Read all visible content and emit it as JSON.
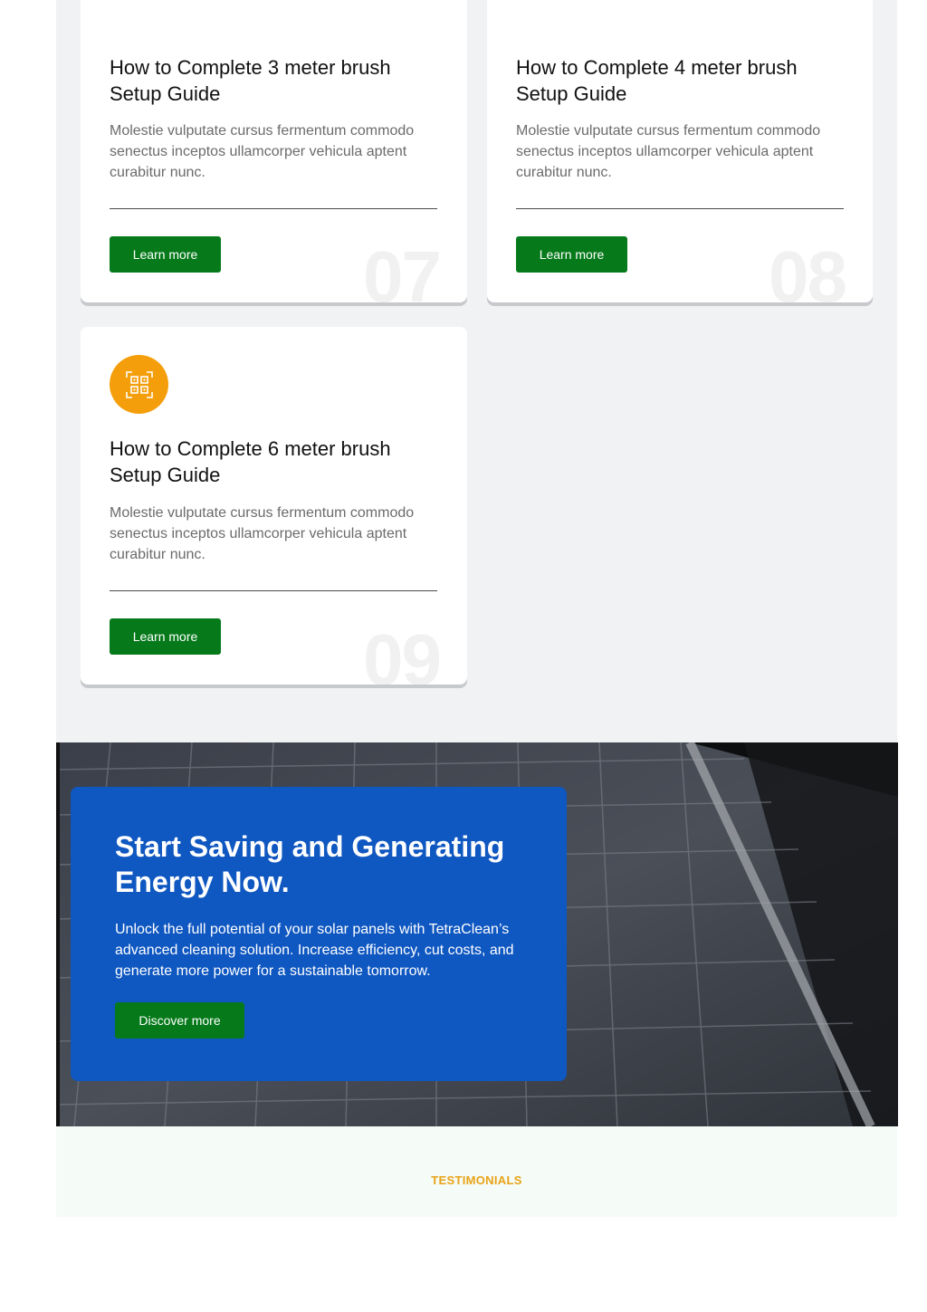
{
  "cards": [
    {
      "title": "How to Complete 3 meter brush Setup Guide",
      "description": "Molestie vulputate cursus fermentum commodo senectus inceptos ullamcorper vehicula aptent curabitur nunc.",
      "button_label": "Learn more",
      "number": "07"
    },
    {
      "title": "How to Complete 4 meter brush Setup Guide",
      "description": "Molestie vulputate cursus fermentum commodo senectus inceptos ullamcorper vehicula aptent curabitur nunc.",
      "button_label": "Learn more",
      "number": "08"
    },
    {
      "title": "How to Complete 6 meter brush Setup Guide",
      "description": "Molestie vulputate cursus fermentum commodo senectus inceptos ullamcorper vehicula aptent curabitur nunc.",
      "button_label": "Learn more",
      "number": "09",
      "icon": "qr-code-icon"
    }
  ],
  "cta": {
    "heading": "Start Saving and Generating Energy Now.",
    "text": "Unlock the full potential of your solar panels with TetraClean’s advanced cleaning solution. Increase efficiency, cut costs, and generate more power for a sustainable tomorrow.",
    "button_label": "Discover more",
    "background": "solar-panel-photo"
  },
  "testimonials": {
    "label": "TESTIMONIALS"
  },
  "colors": {
    "button_green": "#067a1a",
    "cta_blue": "#0f57c1",
    "icon_orange": "#f59e0b",
    "label_orange": "#e8a317",
    "section_gray": "#f1f2f4"
  }
}
